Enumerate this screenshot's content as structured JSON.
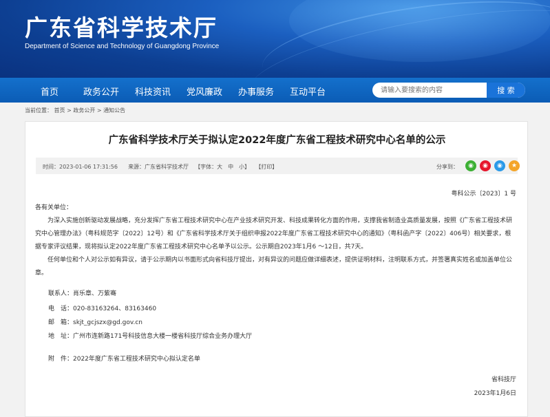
{
  "header": {
    "title": "广东省科学技术厅",
    "subtitle": "Department of Science and Technology of Guangdong Province"
  },
  "nav": {
    "items": [
      "首页",
      "政务公开",
      "科技资讯",
      "党风廉政",
      "办事服务",
      "互动平台"
    ]
  },
  "search": {
    "placeholder": "请输入要搜索的内容",
    "button_label": "搜 索"
  },
  "breadcrumb": {
    "prefix": "当前位置：",
    "items": [
      "首页",
      "政务公开",
      "通知公告"
    ],
    "separator": " > "
  },
  "article": {
    "title": "广东省科学技术厅关于拟认定2022年度广东省工程技术研究中心名单的公示",
    "time_label": "时间：2023-01-06 17:31:56",
    "source_label": "来源：广东省科学技术厅",
    "font_label": "【字体：",
    "font_large": "大",
    "font_medium": "中",
    "font_small": "小",
    "font_close": "】",
    "print_label": "【打印】",
    "share_label": "分享到：",
    "doc_number": "粤科公示〔2023〕1 号",
    "salutation": "各有关单位：",
    "paragraph1": "为深入实施创新驱动发展战略，充分发挥广东省工程技术研究中心在产业技术研究开发、科技成果转化方面的作用，支撑我省制造业高质量发展，按照《广东省工程技术研究中心管理办法》（粤科规范字〔2022〕12号）和《广东省科学技术厅关于组织申报2022年度广东省工程技术研究中心的通知》（粤科函产字〔2022〕406号）相关要求，根据专家评议结果，现将拟认定2022年度广东省工程技术研究中心名单予以公示。公示期自2023年1月6 ～12日，共7天。",
    "paragraph2": "任何单位和个人对公示如有异议，请于公示期内以书面形式向省科技厅提出，对有异议的问题应做详细表述，提供证明材料，注明联系方式，并签署真实姓名或加盖单位公章。",
    "contact_person": "联系人：肖乐章、万紫骞",
    "phone": "电　话：020-83163264、83163460",
    "email": "邮　箱：skjt_gcjszx@gd.gov.cn",
    "address": "地　址：广州市连新路171号科技信息大楼一楼省科技厅综合业务办理大厅",
    "attachment": "附　件：2022年度广东省工程技术研究中心拟认定名单",
    "signer": "省科技厅",
    "date": "2023年1月6日"
  },
  "share_icons": [
    {
      "name": "wechat-icon",
      "color": "#3cb034",
      "glyph": "◉"
    },
    {
      "name": "weibo-icon",
      "color": "#e6162d",
      "glyph": "◉"
    },
    {
      "name": "qzone-icon",
      "color": "#2b9ae8",
      "glyph": "◉"
    },
    {
      "name": "favorite-icon",
      "color": "#f4a52a",
      "glyph": "★"
    }
  ]
}
